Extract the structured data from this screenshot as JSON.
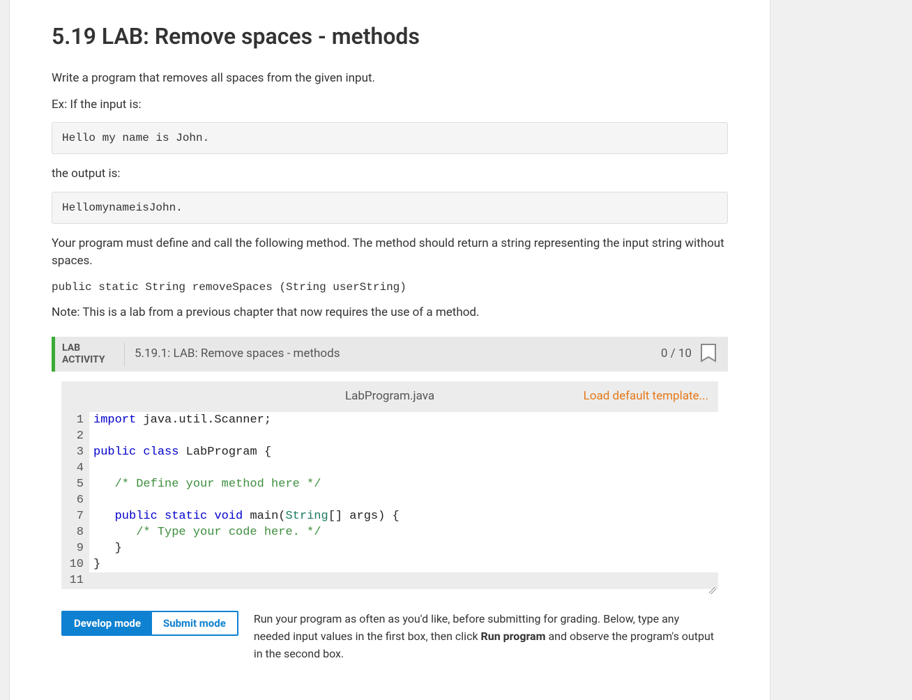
{
  "page": {
    "title": "5.19 LAB: Remove spaces - methods",
    "intro": "Write a program that removes all spaces from the given input.",
    "ex_if_input": "Ex: If the input is:",
    "input_example": "Hello my name is John.",
    "output_is": "the output is:",
    "output_example": "HellomynameisJohn.",
    "method_desc": "Your program must define and call the following method. The method should return a string representing the input string without spaces.",
    "method_sig": "public static String removeSpaces (String userString)",
    "note": "Note: This is a lab from a previous chapter that now requires the use of a method."
  },
  "lab": {
    "label_top": "LAB",
    "label_bottom": "ACTIVITY",
    "title": "5.19.1: LAB: Remove spaces - methods",
    "score": "0 / 10",
    "filename": "LabProgram.java",
    "load_default": "Load default template..."
  },
  "code": {
    "lines": [
      {
        "n": "1"
      },
      {
        "n": "2"
      },
      {
        "n": "3"
      },
      {
        "n": "4"
      },
      {
        "n": "5"
      },
      {
        "n": "6"
      },
      {
        "n": "7"
      },
      {
        "n": "8"
      },
      {
        "n": "9"
      },
      {
        "n": "10"
      },
      {
        "n": "11"
      }
    ],
    "l1_kw": "import",
    "l1_rest": " java.util.Scanner;",
    "l3_kw1": "public",
    "l3_kw2": "class",
    "l3_rest": " LabProgram {",
    "l5_cmt": "   /* Define your method here */",
    "l7_kw1": "public",
    "l7_kw2": "static",
    "l7_kw3": "void",
    "l7_main": " main(",
    "l7_type": "String",
    "l7_rest": "[] args) {",
    "l8_cmt": "      /* Type your code here. */",
    "l9": "   }",
    "l10": "}"
  },
  "modes": {
    "develop": "Develop mode",
    "submit": "Submit mode",
    "desc_pre": "Run your program as often as you'd like, before submitting for grading. Below, type any needed input values in the first box, then click ",
    "desc_bold": "Run program",
    "desc_post": " and observe the program's output in the second box."
  }
}
